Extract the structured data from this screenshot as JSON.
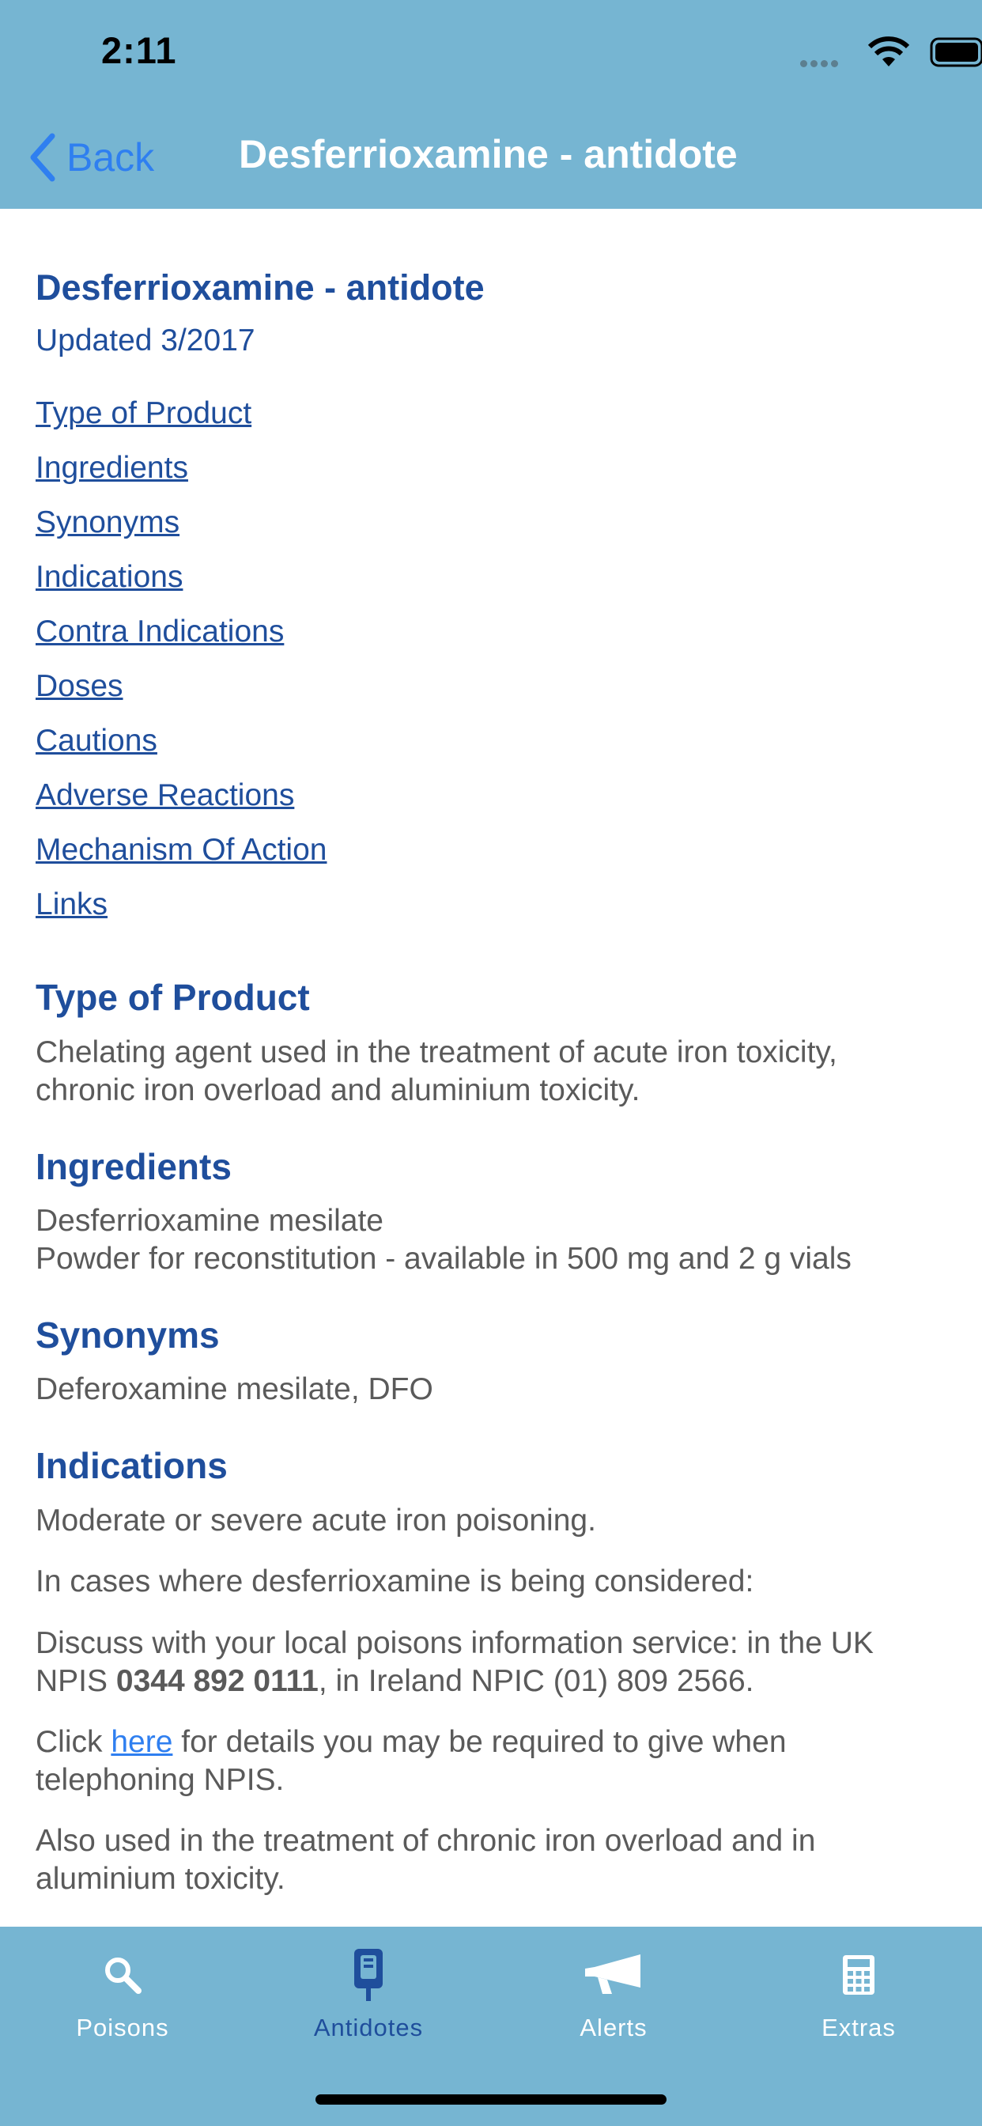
{
  "status_bar": {
    "time": "2:11"
  },
  "nav": {
    "back_label": "Back",
    "title": "Desferrioxamine - antidote"
  },
  "content": {
    "title": "Desferrioxamine - antidote",
    "updated": "Updated 3/2017",
    "toc": [
      "Type of Product",
      "Ingredients",
      "Synonyms",
      "Indications",
      "Contra Indications",
      "Doses",
      "Cautions",
      "Adverse Reactions",
      "Mechanism Of Action",
      "Links"
    ],
    "sections": {
      "type_of_product": {
        "heading": "Type of Product",
        "text": "Chelating agent used in the treatment of acute iron toxicity, chronic iron overload and aluminium toxicity."
      },
      "ingredients": {
        "heading": "Ingredients",
        "line1": "Desferrioxamine mesilate",
        "line2": "Powder for reconstitution - available in 500 mg and 2 g vials"
      },
      "synonyms": {
        "heading": "Synonyms",
        "text": "Deferoxamine mesilate, DFO"
      },
      "indications": {
        "heading": "Indications",
        "p1": "Moderate or severe acute iron poisoning.",
        "p2": "In cases where desferrioxamine is being considered:",
        "p3_pre": "Discuss with your local poisons information service: in the UK NPIS ",
        "p3_phone": "0344 892 0111",
        "p3_post": ", in Ireland NPIC (01) 809 2566.",
        "p4_pre": "Click ",
        "p4_link": "here",
        "p4_post": " for details you may be required to give when telephoning NPIS.",
        "p5": "Also used in the treatment of chronic iron overload and in aluminium toxicity."
      }
    }
  },
  "tabbar": {
    "tabs": [
      {
        "label": "Poisons",
        "icon": "search-icon",
        "active": false
      },
      {
        "label": "Antidotes",
        "icon": "antidote-icon",
        "active": true
      },
      {
        "label": "Alerts",
        "icon": "megaphone-icon",
        "active": false
      },
      {
        "label": "Extras",
        "icon": "calculator-icon",
        "active": false
      }
    ]
  },
  "colors": {
    "header_bg": "#76b5d2",
    "heading_blue": "#1f4e9c",
    "link_blue": "#2f7ff0",
    "body_gray": "#5a5a5a"
  }
}
